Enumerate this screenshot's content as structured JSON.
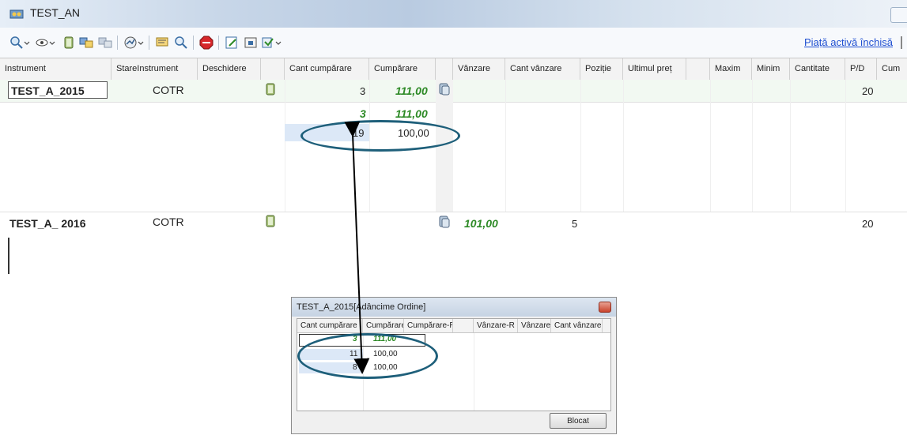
{
  "window": {
    "title": "TEST_AN"
  },
  "toolbar": {
    "icons": [
      "search-dropdown-icon",
      "eye-dropdown-icon",
      "order-icon",
      "windows-icon",
      "windows-gray-icon",
      "chart-dropdown-icon",
      "message-icon",
      "search-small-icon",
      "stop-icon",
      "edit-icon",
      "export-icon",
      "options-dropdown-icon"
    ],
    "market_status": "Piață activă închisă"
  },
  "grid": {
    "columns": [
      "Instrument",
      "StareInstrument",
      "Deschidere",
      "",
      "Cant cumpărare",
      "Cumpărare",
      "",
      "Vânzare",
      "Cant vânzare",
      "Poziție",
      "Ultimul preț",
      "",
      "Maxim",
      "Minim",
      "Cantitate",
      "P/D",
      "Cum"
    ],
    "rows": [
      {
        "instrument": "TEST_A_2015",
        "status": "COTR",
        "cant_cumparare": "3",
        "cumparare": "111,00",
        "pd": "20"
      },
      {
        "instrument": "TEST_A_ 2016",
        "status": "COTR",
        "vanzare": "101,00",
        "cant_vanzare": "5",
        "pd": "20"
      }
    ],
    "depth": [
      {
        "cant": "3",
        "pret": "111,00"
      },
      {
        "cant": "19",
        "pret": "100,00"
      }
    ]
  },
  "dialog": {
    "title": "TEST_A_2015[Adâncime Ordine]",
    "columns": [
      "Cant cumpărare",
      "Cumpărare",
      "Cumpărare-R",
      "",
      "Vânzare-R",
      "Vânzare",
      "Cant vânzare"
    ],
    "rows": [
      {
        "cant": "3",
        "pret": "111,00"
      },
      {
        "cant": "11",
        "pret": "100,00"
      },
      {
        "cant": "8",
        "pret": "100,00"
      }
    ],
    "button_label": "Blocat"
  },
  "colors": {
    "accent_green": "#2d8a26",
    "annotation": "#1e5f7a",
    "link": "#1f4fd1"
  }
}
